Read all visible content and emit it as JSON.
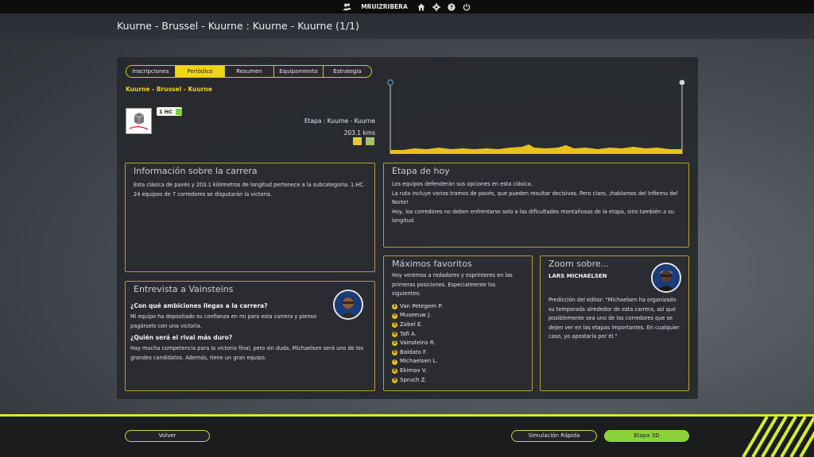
{
  "topbar": {
    "username": "MRUIZRIBERA",
    "icons": [
      "users-icon",
      "home-icon",
      "gear-icon",
      "help-icon",
      "power-icon"
    ]
  },
  "header": {
    "title": "Kuurne - Brussel - Kuurne : Kuurne - Kuurne (1/1)"
  },
  "tabs": [
    {
      "label": "Inscripciones",
      "active": false
    },
    {
      "label": "Periódico",
      "active": true
    },
    {
      "label": "Resumen",
      "active": false
    },
    {
      "label": "Equipamiento",
      "active": false
    },
    {
      "label": "Estrategia",
      "active": false
    }
  ],
  "race": {
    "name": "Kuurne - Brussel - Kuurne",
    "category": "1 HC",
    "stage_label": "Etapa : Kuurne - Kuurne",
    "distance": "203.1 kms"
  },
  "info": {
    "title": "Información sobre la carrera",
    "text": "Esta clásica de pavés y 203.1 kilómetros de longitud pertenece a la subcategoría: 1.HC. 24 equipos de 7 corredores se disputarán la victoria."
  },
  "today": {
    "title": "Etapa de hoy",
    "lines": [
      "Los equipos defenderán sus opciones en esta clásica.",
      "La ruta incluye varios tramos de pavés, que pueden resultar decisivos. Pero claro, ¡hablamos del Infierno del Norte!",
      "Hoy, los corredores no deben enfrentarse solo a las dificultades montañosas de la etapa, sino también a su longitud."
    ]
  },
  "interview": {
    "title": "Entrevista a Vainsteins",
    "q1": "¿Con qué ambiciones llegas a la carrera?",
    "a1": "Mi equipo ha depositado su confianza en mí para esta carrera y pienso pagárselo con una victoria.",
    "q2": "¿Quién será el rival más duro?",
    "a2": "Hay mucha competencia para la victoria final, pero sin duda, Michaelsen será uno de los grandes candidatos. Además, tiene un gran equipo."
  },
  "favorites": {
    "title": "Máximos favoritos",
    "intro": "Hoy veremos a rodadores y esprinteres en las primeras posiciones. Especialmente los siguientes:",
    "riders": [
      "Van Petegem P.",
      "Museeuw J.",
      "Zabel E.",
      "Tafi A.",
      "Vainsteins R.",
      "Baldato F.",
      "Michaelsen L.",
      "Ekimov V.",
      "Spruch Z."
    ]
  },
  "zoom": {
    "title": "Zoom sobre...",
    "rider": "LARS MICHAELSEN",
    "text": "Predicción del editor:  \"Michaelsen ha organizado su temporada alrededor de esta carrera, así que posiblemente sea uno de los corredores que se dejen ver en las etapas importantes. En cualquier caso, yo apostaría por él.\""
  },
  "buttons": {
    "back": "Volver",
    "quick_sim": "Simulación Rápida",
    "stage3d": "Etapa 3D"
  },
  "colors": {
    "accent": "#f0d417",
    "green": "#8ad13a",
    "lime": "#d4ec2e"
  }
}
